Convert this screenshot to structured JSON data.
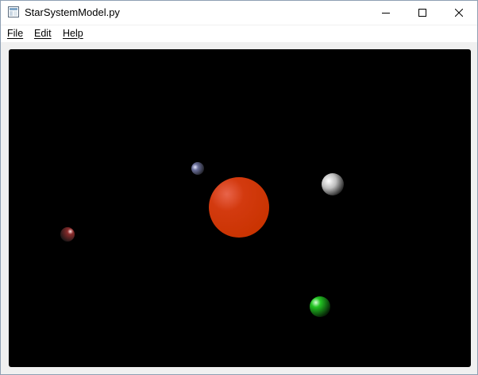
{
  "window": {
    "title": "StarSystemModel.py",
    "app_icon": "python-window-icon",
    "controls": [
      "minimize-icon",
      "maximize-icon",
      "close-icon"
    ]
  },
  "menu": {
    "items": [
      {
        "label": "File"
      },
      {
        "label": "Edit"
      },
      {
        "label": "Help"
      }
    ]
  },
  "scene": {
    "background": "#000000",
    "bodies": [
      {
        "name": "star",
        "color": "#d33a0f"
      },
      {
        "name": "planet-small-blue",
        "color": "#6a6f9a"
      },
      {
        "name": "planet-white",
        "color": "#cfcfcf"
      },
      {
        "name": "planet-red",
        "color": "#8a2b2b"
      },
      {
        "name": "planet-green",
        "color": "#1fb41f"
      }
    ]
  }
}
